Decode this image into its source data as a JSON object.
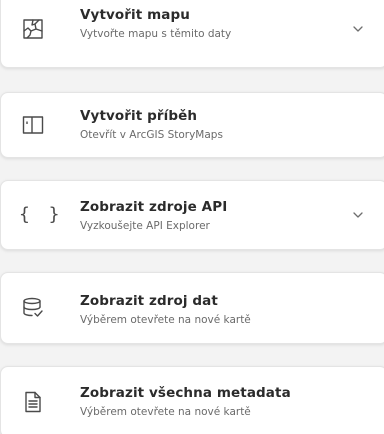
{
  "cards": [
    {
      "title": "Vytvořit mapu",
      "subtitle": "Vytvořte mapu s těmito daty",
      "icon": "map-icon",
      "expandable": true
    },
    {
      "title": "Vytvořit příběh",
      "subtitle": "Otevřít v ArcGIS StoryMaps",
      "icon": "storymap-icon",
      "expandable": false
    },
    {
      "title": "Zobrazit zdroje API",
      "subtitle": "Vyzkoušejte API Explorer",
      "icon": "code-braces-icon",
      "icon_text": "{ }",
      "expandable": true
    },
    {
      "title": "Zobrazit zdroj dat",
      "subtitle": "Výběrem otevřete na nové kartě",
      "icon": "database-icon",
      "expandable": false
    },
    {
      "title": "Zobrazit všechna metadata",
      "subtitle": "Výběrem otevřete na nové kartě",
      "icon": "document-icon",
      "expandable": false
    }
  ]
}
